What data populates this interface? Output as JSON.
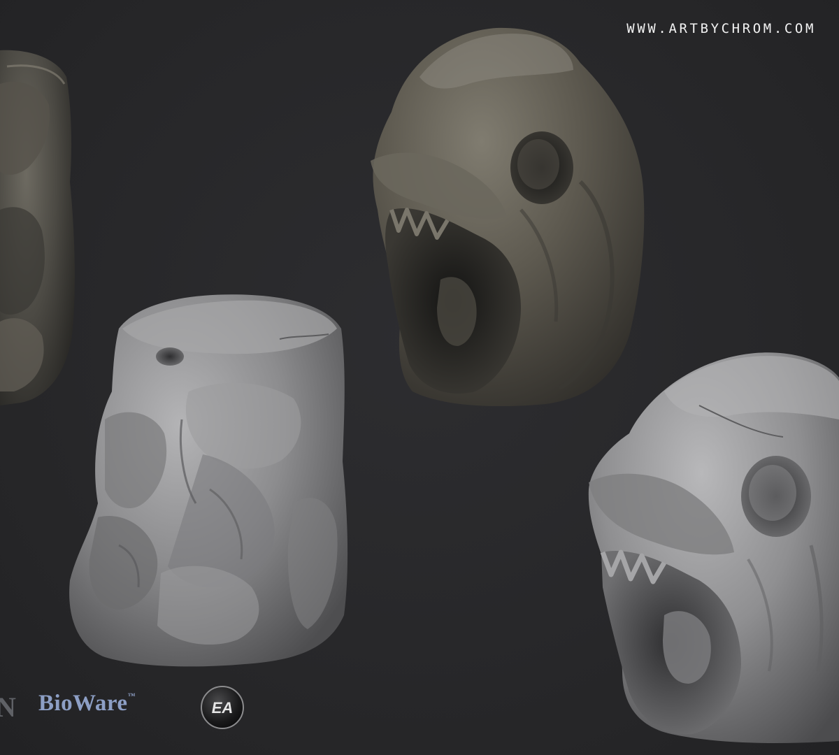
{
  "watermark": {
    "text": "WWW.ARTBYCHROM.COM"
  },
  "logos": {
    "partial_left_letter": "N",
    "bioware": "BioWare",
    "bioware_tm": "™",
    "ea": "EA"
  },
  "renders": [
    {
      "name": "textured-rock-sculpture-left-cropped",
      "material": "textured"
    },
    {
      "name": "clay-sculpt-hunched-creature",
      "material": "clay"
    },
    {
      "name": "textured-skull-rock",
      "material": "textured"
    },
    {
      "name": "clay-sculpt-skull-rock",
      "material": "clay"
    }
  ],
  "colors": {
    "background": "#28282a",
    "clay": "#8e8e90",
    "stone": "#5b584f",
    "bioware_blue": "#8d9fc5"
  }
}
